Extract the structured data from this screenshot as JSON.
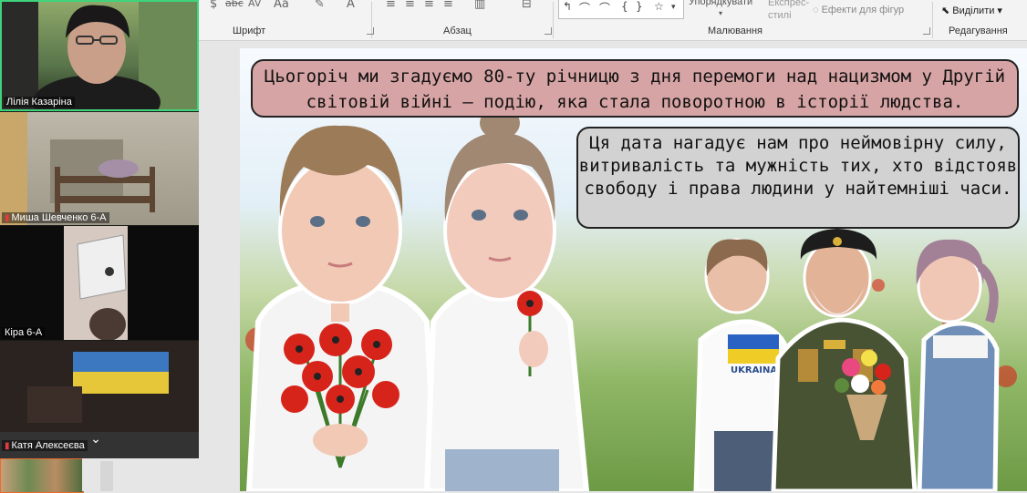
{
  "ribbon": {
    "groups": {
      "font": "Шрифт",
      "paragraph": "Абзац",
      "drawing": "Малювання",
      "editing": "Редагування"
    },
    "arrange_label": "Упорядкувати",
    "quick_styles_label": "Експрес-стилі",
    "shape_effects_label": "Ефекти для фігур",
    "select_label": "Виділити"
  },
  "participants": [
    {
      "name": "Лілія Казаріна",
      "active_speaker": true,
      "muted": false
    },
    {
      "name": "Миша Шевченко 6-А",
      "muted": true
    },
    {
      "name": "Кіра 6-А",
      "muted": false
    },
    {
      "name": "Катя Алексеєва",
      "muted": true
    }
  ],
  "slide": {
    "caption_top": "Цьогоріч ми згадуємо 80-ту річницю з дня перемоги над нацизмом у Другій світовій війні — подію, яка стала поворотною в історії людства.",
    "caption_right": "Ця дата нагадує нам про неймовірну силу, витривалість та мужність тих, хто відстояв свободу і права людини у найтемніші часи.",
    "shirt_text": "UKRAINA"
  },
  "colors": {
    "active_speaker_border": "#3fd47c",
    "caption_top_bg": "#d7a4a5",
    "caption_right_bg": "#d2d2d2",
    "poppy_red": "#d6241b"
  }
}
